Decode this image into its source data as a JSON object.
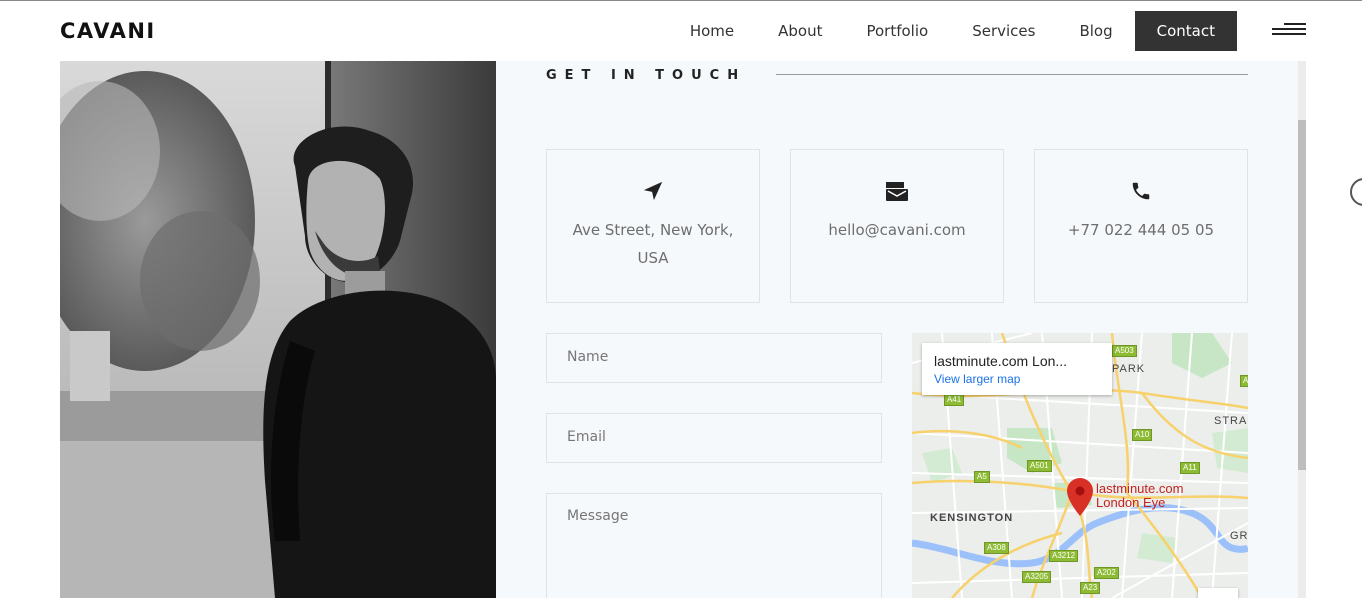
{
  "header": {
    "logo": "CAVANI",
    "nav": [
      {
        "label": "Home"
      },
      {
        "label": "About"
      },
      {
        "label": "Portfolio"
      },
      {
        "label": "Services"
      },
      {
        "label": "Blog"
      },
      {
        "label": "Contact",
        "active": true
      }
    ]
  },
  "contact": {
    "title": "GET IN TOUCH",
    "cards": [
      {
        "icon": "location-arrow-icon",
        "text": "Ave Street, New York, USA"
      },
      {
        "icon": "mail-icon",
        "text": "hello@cavani.com"
      },
      {
        "icon": "phone-icon",
        "text": "+77 022 444 05 05"
      }
    ],
    "form": {
      "name_placeholder": "Name",
      "email_placeholder": "Email",
      "message_placeholder": "Message"
    },
    "map": {
      "place_name": "lastminute.com Lon...",
      "larger_map_link": "View larger map",
      "pin_label_line1": "lastminute.com",
      "pin_label_line2": "London Eye",
      "area_labels": [
        "KENSINGTON",
        "PARK",
        "STRA",
        "GR"
      ],
      "road_badges": [
        "A503",
        "A41",
        "A10",
        "A501",
        "A11",
        "A5",
        "A308",
        "A3212",
        "A3205",
        "A202",
        "A23",
        "A"
      ]
    }
  },
  "colors": {
    "nav_active_bg": "#333333",
    "panel_bg": "#f6f9fc",
    "map_pin": "#d93025",
    "link": "#1a73e8"
  }
}
